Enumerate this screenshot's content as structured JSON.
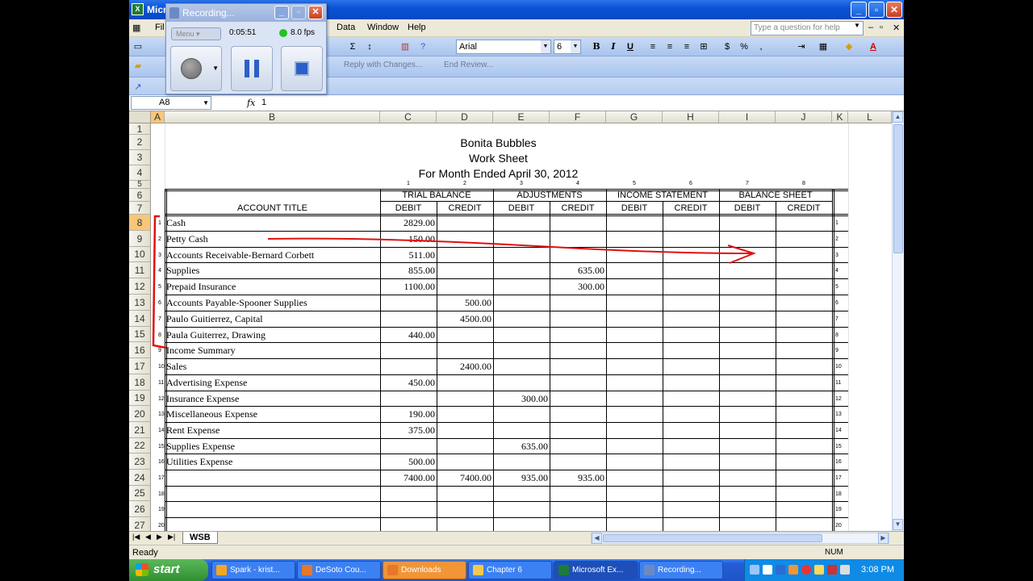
{
  "window": {
    "title": "Micr",
    "controls": [
      "_",
      "▫",
      "✕"
    ]
  },
  "menu": {
    "items": [
      {
        "label": "File",
        "display": "Fil"
      },
      {
        "label": "Data"
      },
      {
        "label": "Window"
      },
      {
        "label": "Help"
      }
    ],
    "help_placeholder": "Type a question for help",
    "doc_controls": [
      "–",
      "▫",
      "✕"
    ]
  },
  "toolbar": {
    "font": "Arial",
    "font_size": "6",
    "bold": "B",
    "italic": "I",
    "underline": "U",
    "currency": "$",
    "percent": "%",
    "sum": "Σ",
    "review": {
      "reply": "Reply with Changes...",
      "end": "End Review..."
    }
  },
  "formula_bar": {
    "name_box": "A8",
    "fx": "fx",
    "value": "1"
  },
  "recording": {
    "title": "Recording...",
    "menu_label": "Menu",
    "elapsed": "0:05:51",
    "fps": "8.0 fps"
  },
  "columns": [
    "A",
    "B",
    "C",
    "D",
    "E",
    "F",
    "G",
    "H",
    "I",
    "J",
    "K",
    "L"
  ],
  "rows": [
    "1",
    "2",
    "3",
    "4",
    "5",
    "6",
    "7",
    "8",
    "9",
    "10",
    "11",
    "12",
    "13",
    "14",
    "15",
    "16",
    "17",
    "18",
    "19",
    "20",
    "21",
    "22",
    "23",
    "24",
    "25",
    "26",
    "27"
  ],
  "worksheet": {
    "company": "Bonita Bubbles",
    "title": "Work Sheet",
    "period": "For Month Ended April 30, 2012",
    "column_numbers": [
      "1",
      "2",
      "3",
      "4",
      "5",
      "6",
      "7",
      "8"
    ],
    "groups": [
      "TRIAL BALANCE",
      "ADJUSTMENTS",
      "INCOME STATEMENT",
      "BALANCE SHEET"
    ],
    "account_header": "ACCOUNT TITLE",
    "subheads": [
      "DEBIT",
      "CREDIT",
      "DEBIT",
      "CREDIT",
      "DEBIT",
      "CREDIT",
      "DEBIT",
      "CREDIT"
    ],
    "accounts": [
      {
        "line": "1",
        "title": "Cash",
        "tb_debit": "2829.00",
        "tb_credit": "",
        "adj_debit": "",
        "adj_credit": ""
      },
      {
        "line": "2",
        "title": "Petty Cash",
        "tb_debit": "150.00",
        "tb_credit": "",
        "adj_debit": "",
        "adj_credit": ""
      },
      {
        "line": "3",
        "title": "Accounts Receivable-Bernard Corbett",
        "tb_debit": "511.00",
        "tb_credit": "",
        "adj_debit": "",
        "adj_credit": ""
      },
      {
        "line": "4",
        "title": "Supplies",
        "tb_debit": "855.00",
        "tb_credit": "",
        "adj_debit": "",
        "adj_credit": "635.00"
      },
      {
        "line": "5",
        "title": "Prepaid Insurance",
        "tb_debit": "1100.00",
        "tb_credit": "",
        "adj_debit": "",
        "adj_credit": "300.00"
      },
      {
        "line": "6",
        "title": "Accounts Payable-Spooner Supplies",
        "tb_debit": "",
        "tb_credit": "500.00",
        "adj_debit": "",
        "adj_credit": ""
      },
      {
        "line": "7",
        "title": "Paulo Guitierrez, Capital",
        "tb_debit": "",
        "tb_credit": "4500.00",
        "adj_debit": "",
        "adj_credit": ""
      },
      {
        "line": "8",
        "title": "Paula Guiterrez, Drawing",
        "tb_debit": "440.00",
        "tb_credit": "",
        "adj_debit": "",
        "adj_credit": ""
      },
      {
        "line": "9",
        "title": "Income Summary",
        "tb_debit": "",
        "tb_credit": "",
        "adj_debit": "",
        "adj_credit": ""
      },
      {
        "line": "10",
        "title": "Sales",
        "tb_debit": "",
        "tb_credit": "2400.00",
        "adj_debit": "",
        "adj_credit": ""
      },
      {
        "line": "11",
        "title": "Advertising Expense",
        "tb_debit": "450.00",
        "tb_credit": "",
        "adj_debit": "",
        "adj_credit": ""
      },
      {
        "line": "12",
        "title": "Insurance Expense",
        "tb_debit": "",
        "tb_credit": "",
        "adj_debit": "300.00",
        "adj_credit": ""
      },
      {
        "line": "13",
        "title": "Miscellaneous Expense",
        "tb_debit": "190.00",
        "tb_credit": "",
        "adj_debit": "",
        "adj_credit": ""
      },
      {
        "line": "14",
        "title": "Rent Expense",
        "tb_debit": "375.00",
        "tb_credit": "",
        "adj_debit": "",
        "adj_credit": ""
      },
      {
        "line": "15",
        "title": "Supplies Expense",
        "tb_debit": "",
        "tb_credit": "",
        "adj_debit": "635.00",
        "adj_credit": ""
      },
      {
        "line": "16",
        "title": "Utilities Expense",
        "tb_debit": "500.00",
        "tb_credit": "",
        "adj_debit": "",
        "adj_credit": ""
      },
      {
        "line": "17",
        "title": "",
        "tb_debit": "7400.00",
        "tb_credit": "7400.00",
        "adj_debit": "935.00",
        "adj_credit": "935.00"
      },
      {
        "line": "18",
        "title": "",
        "tb_debit": "",
        "tb_credit": "",
        "adj_debit": "",
        "adj_credit": ""
      },
      {
        "line": "19",
        "title": "",
        "tb_debit": "",
        "tb_credit": "",
        "adj_debit": "",
        "adj_credit": ""
      },
      {
        "line": "20",
        "title": "",
        "tb_debit": "",
        "tb_credit": "",
        "adj_debit": "",
        "adj_credit": ""
      }
    ]
  },
  "sheet_tabs": {
    "active": "WSB"
  },
  "status": {
    "left": "Ready",
    "num": "NUM"
  },
  "taskbar": {
    "start": "start",
    "tasks": [
      {
        "label": "Spark - krist...",
        "color": "#f5a623"
      },
      {
        "label": "DeSoto Cou...",
        "color": "#e8762b"
      },
      {
        "label": "Downloads",
        "color": "#e8762b"
      },
      {
        "label": "Chapter 6",
        "color": "#f2c94c"
      },
      {
        "label": "Microsoft Ex...",
        "color": "#1e7a3a"
      },
      {
        "label": "Recording...",
        "color": "#6b8ac4"
      }
    ],
    "clock": "3:08 PM"
  },
  "colors": {
    "annotation": "#e01010",
    "selection": "#f7c67a"
  }
}
